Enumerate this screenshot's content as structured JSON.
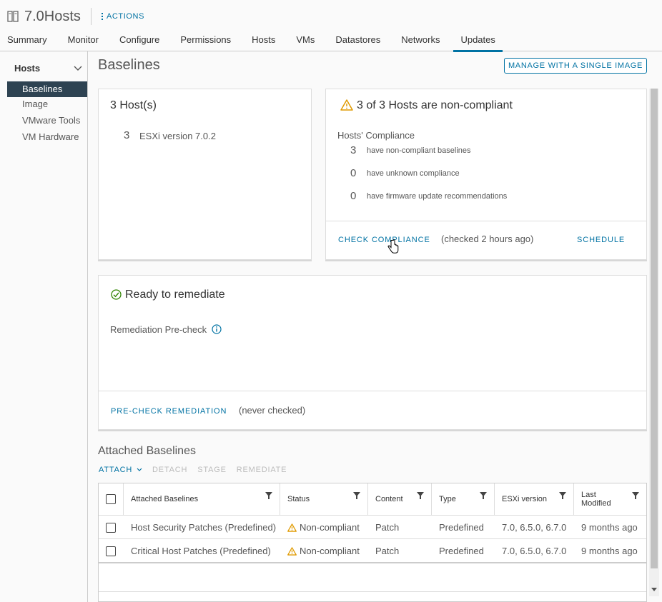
{
  "header": {
    "title": "7.0Hosts",
    "actions_label": "ACTIONS",
    "tabs": [
      {
        "label": "Summary"
      },
      {
        "label": "Monitor"
      },
      {
        "label": "Configure"
      },
      {
        "label": "Permissions"
      },
      {
        "label": "Hosts"
      },
      {
        "label": "VMs"
      },
      {
        "label": "Datastores"
      },
      {
        "label": "Networks"
      },
      {
        "label": "Updates",
        "active": true
      }
    ]
  },
  "sidebar": {
    "group": "Hosts",
    "items": [
      {
        "label": "Baselines",
        "active": true
      },
      {
        "label": "Image"
      },
      {
        "label": "VMware Tools"
      },
      {
        "label": "VM Hardware"
      }
    ]
  },
  "main": {
    "title": "Baselines",
    "manage_button": "MANAGE WITH A SINGLE IMAGE",
    "hosts_card": {
      "title": "3 Host(s)",
      "count": "3",
      "version": "ESXi version 7.0.2"
    },
    "compliance_card": {
      "title": "3 of 3 Hosts are non-compliant",
      "subtitle": "Hosts' Compliance",
      "rows": [
        {
          "count": "3",
          "label": "have non-compliant baselines"
        },
        {
          "count": "0",
          "label": "have unknown compliance"
        },
        {
          "count": "0",
          "label": "have firmware update recommendations"
        }
      ],
      "check_link": "CHECK COMPLIANCE",
      "checked_note": "(checked 2 hours ago)",
      "schedule_link": "SCHEDULE"
    },
    "remediate_card": {
      "title": "Ready to remediate",
      "precheck_label": "Remediation Pre-check",
      "precheck_link": "PRE-CHECK REMEDIATION",
      "precheck_note": "(never checked)"
    },
    "attached": {
      "title": "Attached Baselines",
      "toolbar": {
        "attach": "ATTACH",
        "detach": "DETACH",
        "stage": "STAGE",
        "remediate": "REMEDIATE"
      },
      "columns": {
        "baseline": "Attached Baselines",
        "status": "Status",
        "content": "Content",
        "type": "Type",
        "esxi": "ESXi version",
        "modified": "Last Modified"
      },
      "rows": [
        {
          "baseline": "Host Security Patches (Predefined)",
          "status": "Non-compliant",
          "content": "Patch",
          "type": "Predefined",
          "esxi": "7.0, 6.5.0, 6.7.0",
          "modified": "9 months ago"
        },
        {
          "baseline": "Critical Host Patches (Predefined)",
          "status": "Non-compliant",
          "content": "Patch",
          "type": "Predefined",
          "esxi": "7.0, 6.5.0, 6.7.0",
          "modified": "9 months ago"
        }
      ]
    }
  },
  "colors": {
    "accent": "#0072a3",
    "warning": "#e09a00",
    "success": "#2f8400",
    "sidebar_active": "#2e4352"
  }
}
